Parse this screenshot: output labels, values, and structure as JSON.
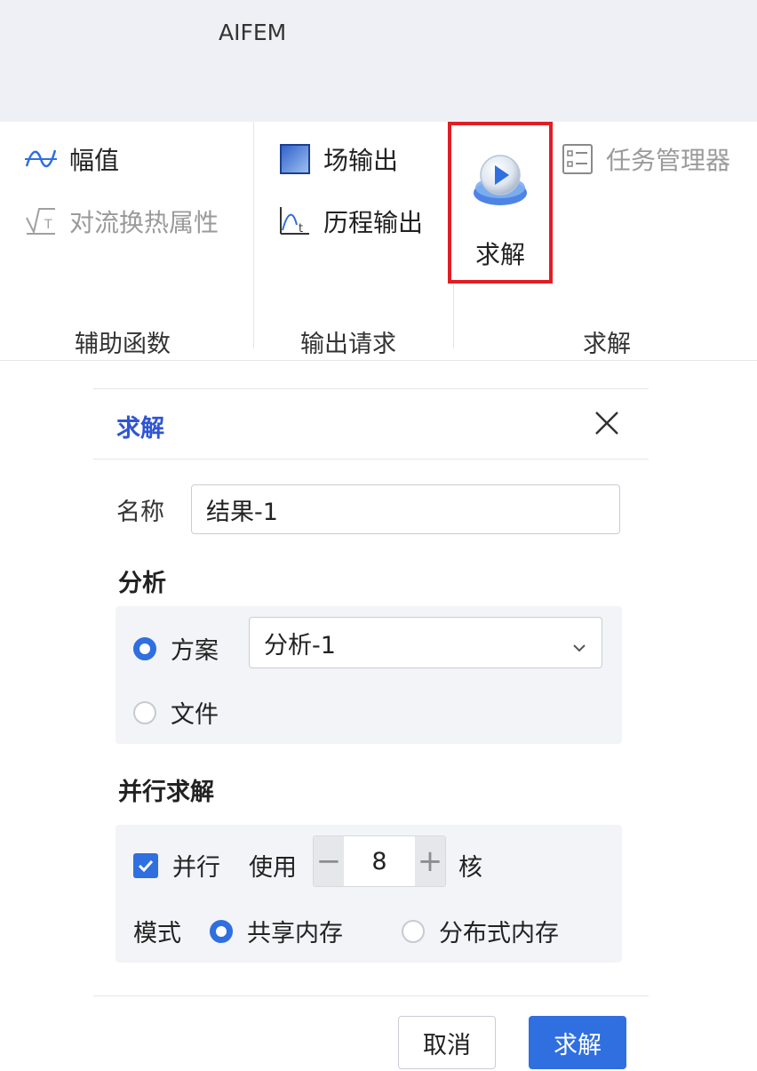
{
  "app": {
    "title": "AIFEM"
  },
  "ribbon": {
    "aux_functions": {
      "label": "辅助函数",
      "items": [
        {
          "label": "幅值",
          "icon": "amplitude-icon",
          "enabled": true
        },
        {
          "label": "对流换热属性",
          "icon": "convection-icon",
          "enabled": false
        }
      ]
    },
    "output_requests": {
      "label": "输出请求",
      "items": [
        {
          "label": "场输出",
          "icon": "field-output-icon",
          "enabled": true
        },
        {
          "label": "历程输出",
          "icon": "history-output-icon",
          "enabled": true
        }
      ]
    },
    "solve": {
      "label": "求解",
      "solve_button": {
        "label": "求解",
        "icon": "solve-play-icon",
        "highlighted": true,
        "highlight_color": "#e01e24"
      },
      "task_manager": {
        "label": "任务管理器",
        "icon": "task-list-icon",
        "enabled": false
      }
    }
  },
  "dialog": {
    "title": "求解",
    "name_label": "名称",
    "name_value": "结果-1",
    "analysis": {
      "section_title": "分析",
      "option_scheme": "方案",
      "option_file": "文件",
      "selected_option": "方案",
      "scheme_select_value": "分析-1"
    },
    "parallel": {
      "section_title": "并行求解",
      "checkbox_label": "并行",
      "checked": true,
      "use_label": "使用",
      "cores": "8",
      "cores_unit": "核",
      "decrement": "−",
      "increment": "+",
      "mode_label": "模式",
      "mode_shared": "共享内存",
      "mode_distributed": "分布式内存",
      "selected_mode": "共享内存"
    },
    "buttons": {
      "cancel": "取消",
      "solve": "求解"
    }
  },
  "colors": {
    "accent": "#2f6fe0",
    "title_blue": "#2f55d4",
    "highlight_red": "#e01e24"
  }
}
